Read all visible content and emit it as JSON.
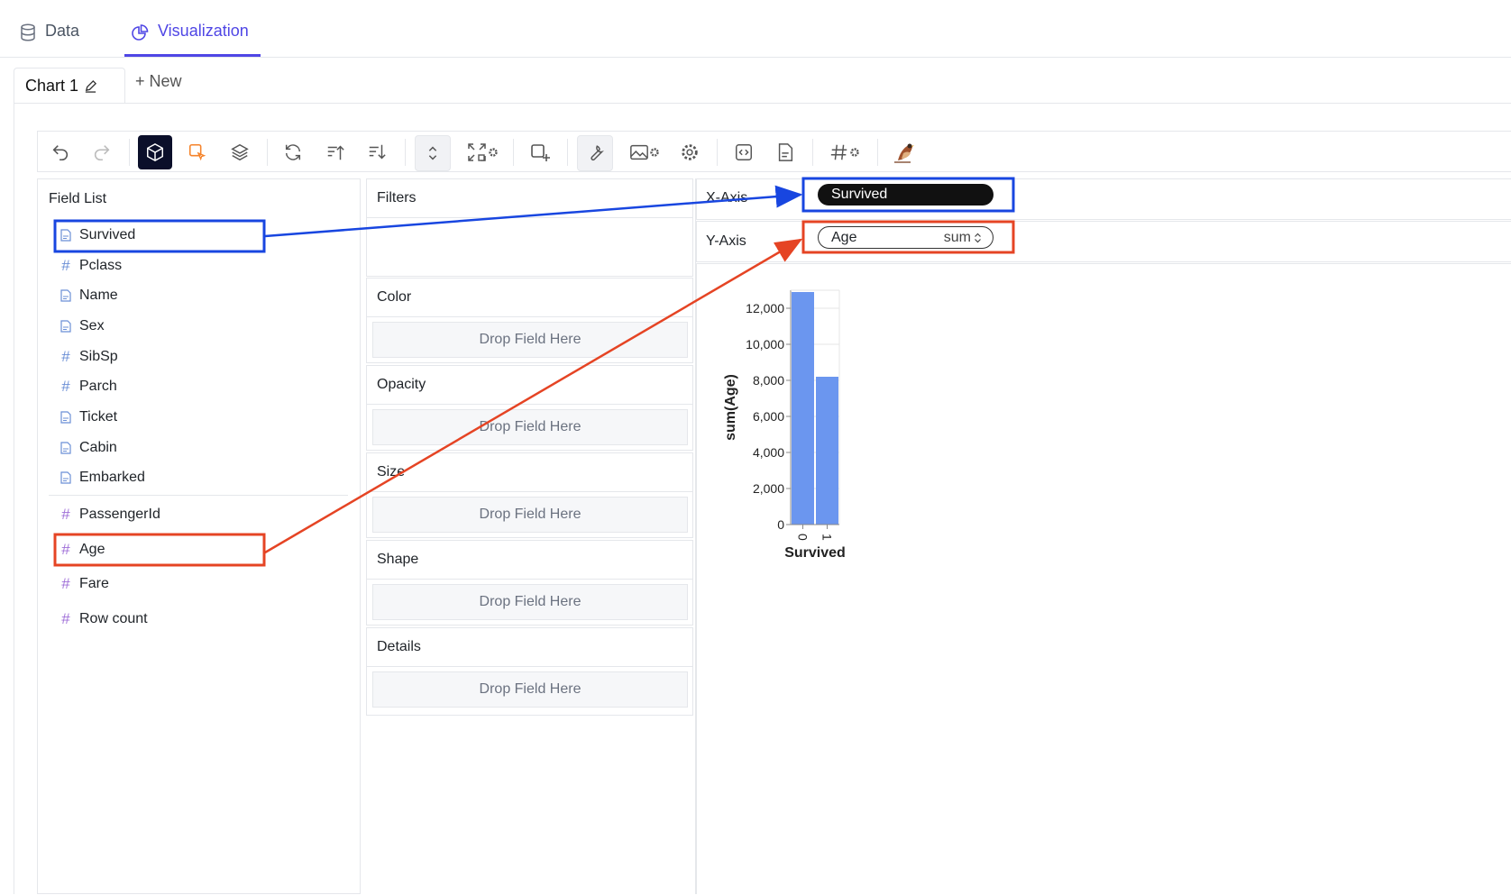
{
  "top_tabs": [
    {
      "label": "Data",
      "icon": "database-icon"
    },
    {
      "label": "Visualization",
      "icon": "pie-chart-icon"
    }
  ],
  "chart_tabs": {
    "current": "Chart 1",
    "new_label": "+ New"
  },
  "field_list": {
    "title": "Field List",
    "dimensions": [
      {
        "name": "Survived",
        "type": "text"
      },
      {
        "name": "Pclass",
        "type": "number"
      },
      {
        "name": "Name",
        "type": "text"
      },
      {
        "name": "Sex",
        "type": "text"
      },
      {
        "name": "SibSp",
        "type": "number"
      },
      {
        "name": "Parch",
        "type": "number"
      },
      {
        "name": "Ticket",
        "type": "text"
      },
      {
        "name": "Cabin",
        "type": "text"
      },
      {
        "name": "Embarked",
        "type": "text"
      }
    ],
    "measures": [
      {
        "name": "PassengerId"
      },
      {
        "name": "Age"
      },
      {
        "name": "Fare"
      },
      {
        "name": "Row count"
      }
    ]
  },
  "encodings": {
    "filters": "Filters",
    "drop_placeholder": "Drop Field Here",
    "channels": [
      "Color",
      "Opacity",
      "Size",
      "Shape",
      "Details"
    ]
  },
  "axes": {
    "x_label": "X-Axis",
    "y_label": "Y-Axis",
    "x_field": "Survived",
    "y_field": "Age",
    "y_aggregation": "sum"
  },
  "colors": {
    "accent": "#4f46e5",
    "bar": "#6b96ef",
    "annotation_blue": "#1846e0",
    "annotation_red": "#e54424",
    "toolbar_orange": "#f5832a"
  },
  "chart_data": {
    "type": "bar",
    "categories": [
      "0",
      "1"
    ],
    "values": [
      12900,
      8200
    ],
    "xlabel": "Survived",
    "ylabel": "sum(Age)",
    "yticks": [
      "0",
      "2,000",
      "4,000",
      "6,000",
      "8,000",
      "10,000",
      "12,000"
    ],
    "ylim": [
      0,
      13000
    ]
  }
}
